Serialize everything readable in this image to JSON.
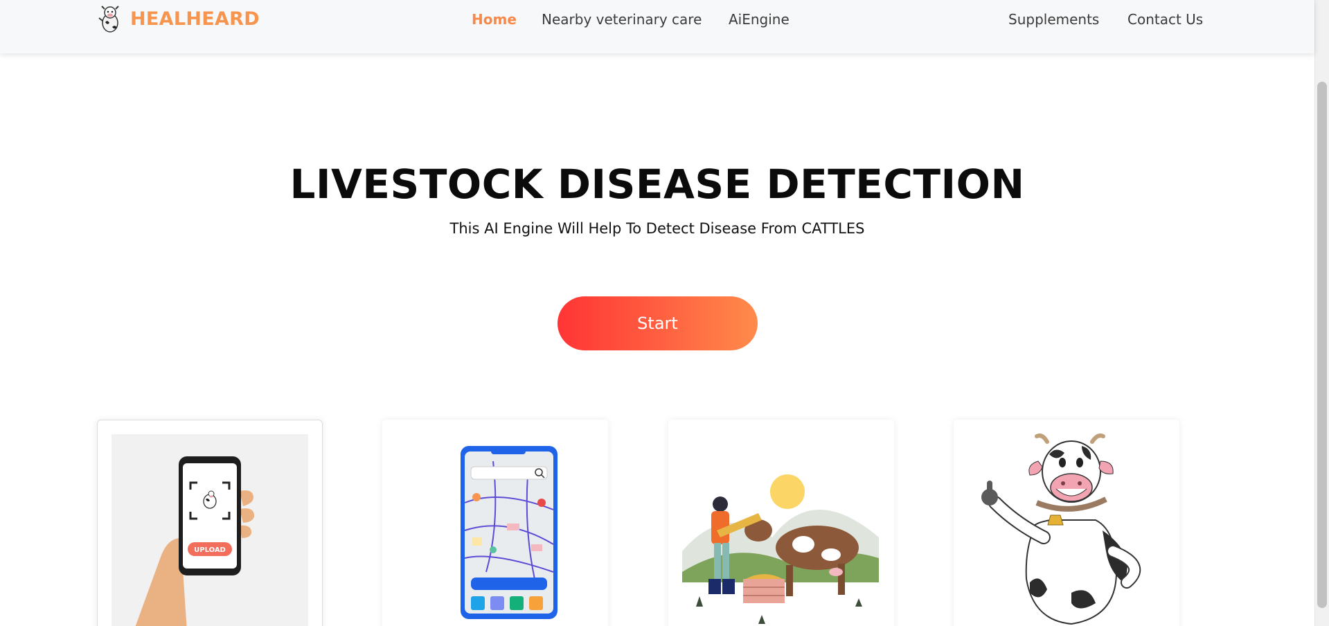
{
  "navbar": {
    "brand": "HEALHEARD",
    "links": [
      {
        "label": "Home",
        "active": true
      },
      {
        "label": "Nearby veterinary care",
        "active": false
      },
      {
        "label": "AiEngine",
        "active": false
      },
      {
        "label": "Supplements",
        "active": false
      },
      {
        "label": "Contact Us",
        "active": false
      }
    ]
  },
  "hero": {
    "title": "LIVESTOCK DISEASE DETECTION",
    "subtitle": "This AI Engine Will Help To Detect Disease From CATTLES",
    "start_label": "Start"
  },
  "cards": [
    {
      "illustration": "phone-upload-illustration",
      "upload_label": "UPLOAD"
    },
    {
      "illustration": "map-app-illustration"
    },
    {
      "illustration": "farmer-feeding-cow-illustration"
    },
    {
      "illustration": "cartoon-cow-thumbs-up-illustration"
    }
  ],
  "colors": {
    "brand": "#f7954f",
    "active_link": "#f7894a",
    "button_gradient_start": "#ff3535",
    "button_gradient_end": "#ff8b4b"
  }
}
